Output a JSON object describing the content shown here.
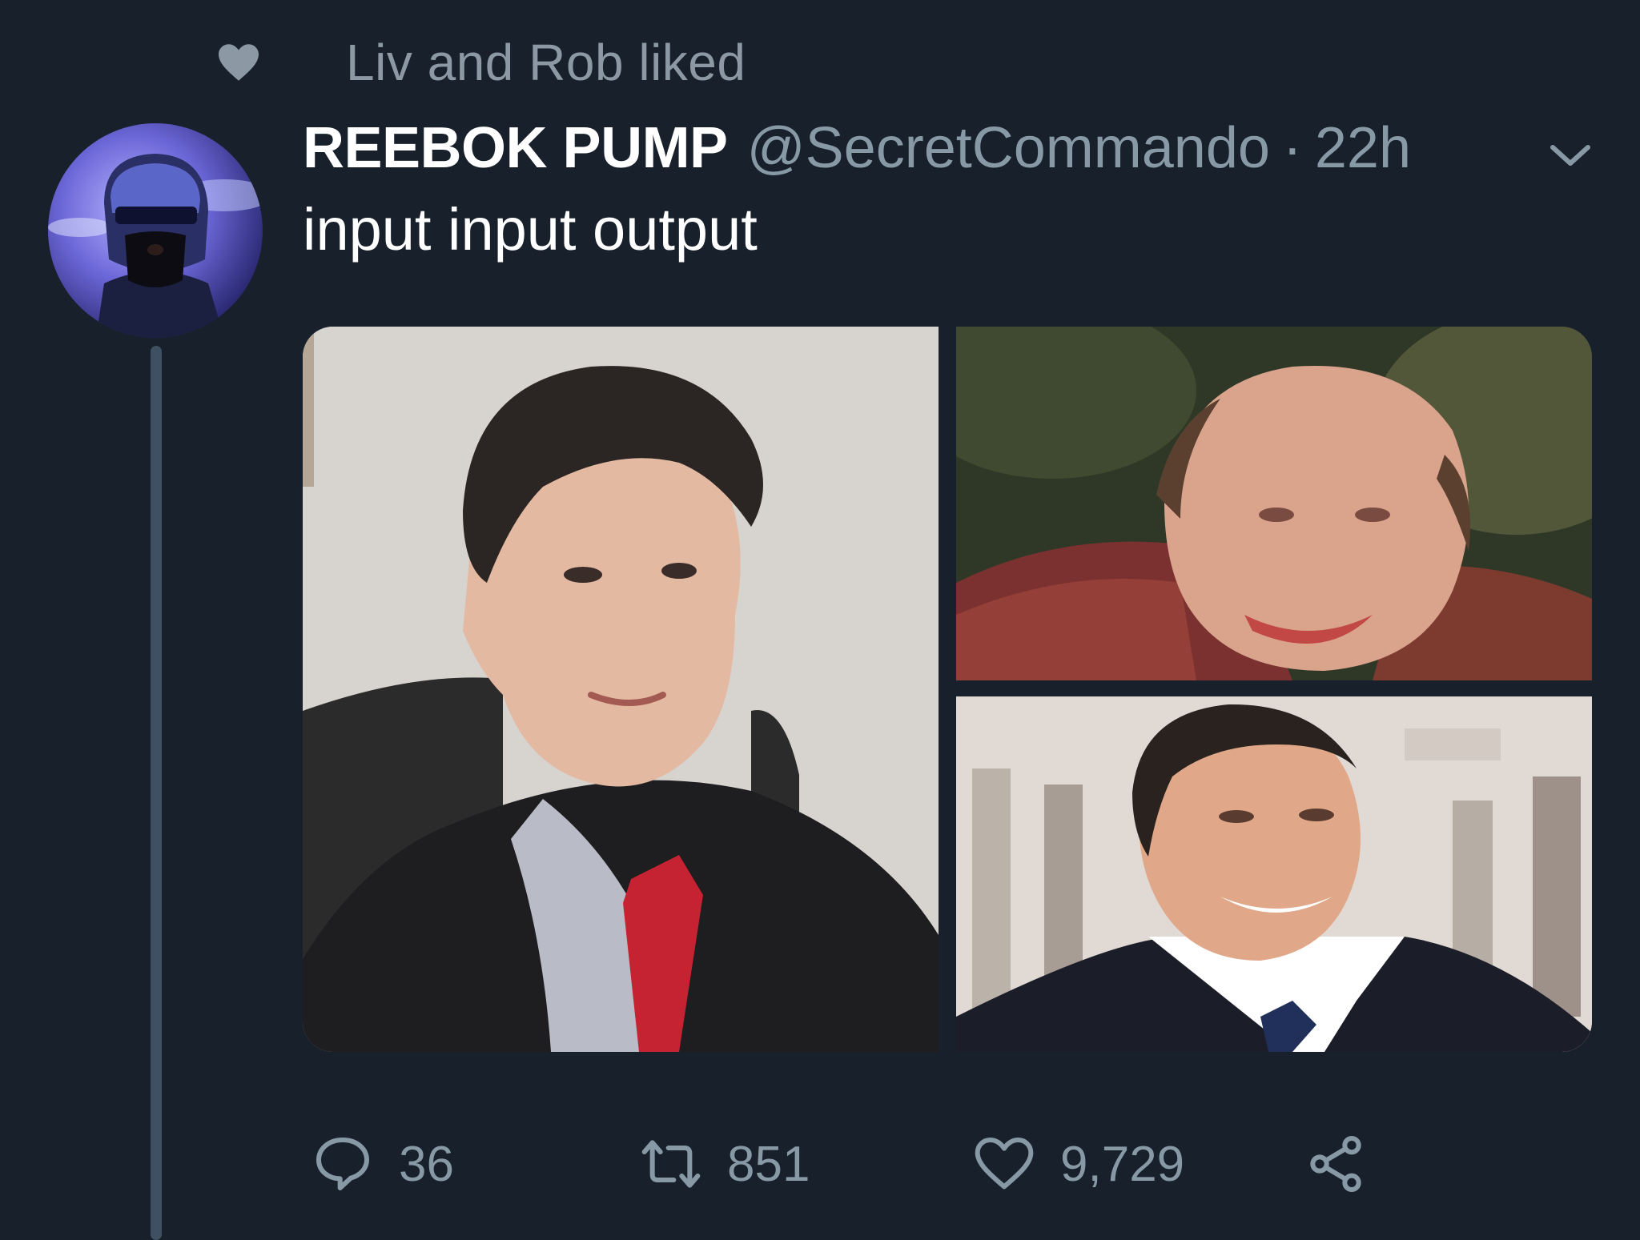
{
  "social_context": {
    "icon": "heart-icon",
    "text": "Liv and Rob liked"
  },
  "tweet": {
    "display_name": "REEBOK PUMP",
    "handle": "@SecretCommando",
    "separator": "·",
    "time": "22h",
    "text": "input input output",
    "media": [
      {
        "position": "left",
        "kind": "photo"
      },
      {
        "position": "top-right",
        "kind": "photo"
      },
      {
        "position": "bottom-right",
        "kind": "photo"
      }
    ]
  },
  "actions": {
    "reply_count": "36",
    "retweet_count": "851",
    "like_count": "9,729"
  },
  "colors": {
    "background": "#17202b",
    "secondary_text": "#8899a6",
    "thread_line": "#3f5062"
  }
}
